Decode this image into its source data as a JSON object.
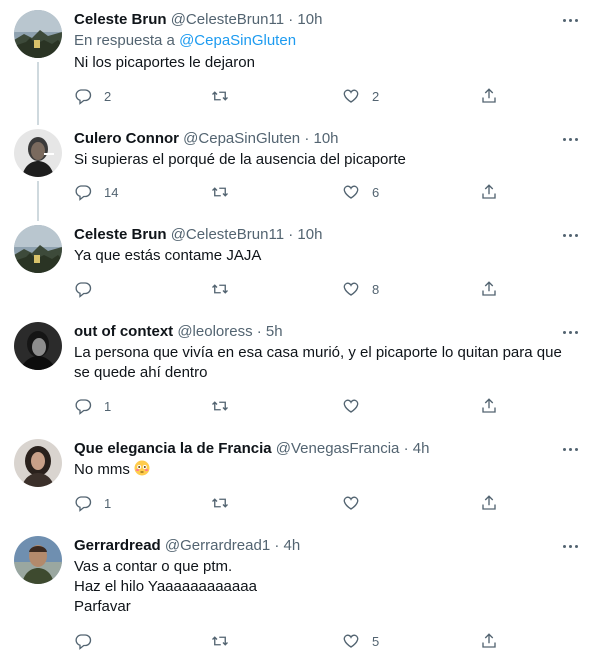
{
  "tweets": [
    {
      "name": "Celeste Brun",
      "handle": "@CelesteBrun11",
      "time": "· 10h",
      "reply_prefix": "En respuesta a",
      "reply_handle": "@CepaSinGluten",
      "text": [
        "Ni los picaportes le dejaron"
      ],
      "replies": "2",
      "retweets": "",
      "likes": "2"
    },
    {
      "name": "Culero Connor",
      "handle": "@CepaSinGluten",
      "time": "· 10h",
      "text": [
        "Si supieras el porqué de la ausencia del picaporte"
      ],
      "replies": "14",
      "retweets": "",
      "likes": "6"
    },
    {
      "name": "Celeste Brun",
      "handle": "@CelesteBrun11",
      "time": "· 10h",
      "text": [
        "Ya que estás contame JAJA"
      ],
      "replies": "",
      "retweets": "",
      "likes": "8"
    },
    {
      "name": "out of context",
      "handle": "@leoloress",
      "time": "· 5h",
      "text": [
        "La persona que vivía en esa casa murió, y el picaporte lo quitan para que",
        "se quede ahí dentro"
      ],
      "replies": "1",
      "retweets": "",
      "likes": ""
    },
    {
      "name": "Que elegancia la de Francia",
      "handle": "@VenegasFrancia",
      "time": "· 4h",
      "text": [
        "No mms"
      ],
      "emoji": "flushed-face-emoji",
      "replies": "1",
      "retweets": "",
      "likes": ""
    },
    {
      "name": "Gerrardread",
      "handle": "@Gerrardread1",
      "time": "· 4h",
      "text": [
        "Vas a contar o que ptm.",
        "Haz el hilo Yaaaaaaaaaaaa",
        "Parfavar"
      ],
      "replies": "",
      "retweets": "",
      "likes": "5"
    }
  ],
  "colors": {
    "text": "#0f1419",
    "secondary": "#536471",
    "link": "#1d9bf0",
    "thread_line": "#cfd9de"
  }
}
